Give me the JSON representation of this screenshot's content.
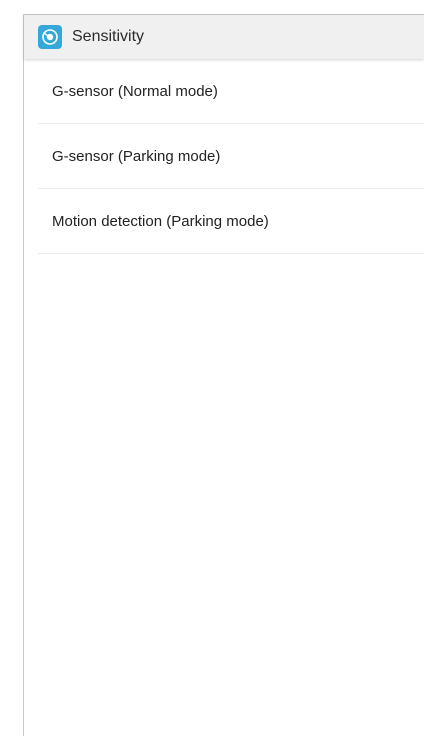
{
  "header": {
    "title": "Sensitivity",
    "icon": "dashcam-app-icon"
  },
  "menu": {
    "items": [
      {
        "label": "G-sensor (Normal mode)"
      },
      {
        "label": "G-sensor (Parking mode)"
      },
      {
        "label": "Motion detection (Parking mode)"
      }
    ]
  },
  "colors": {
    "accent": "#34a8d8",
    "titlebar_bg": "#f0f0f0",
    "divider": "#ececec"
  }
}
